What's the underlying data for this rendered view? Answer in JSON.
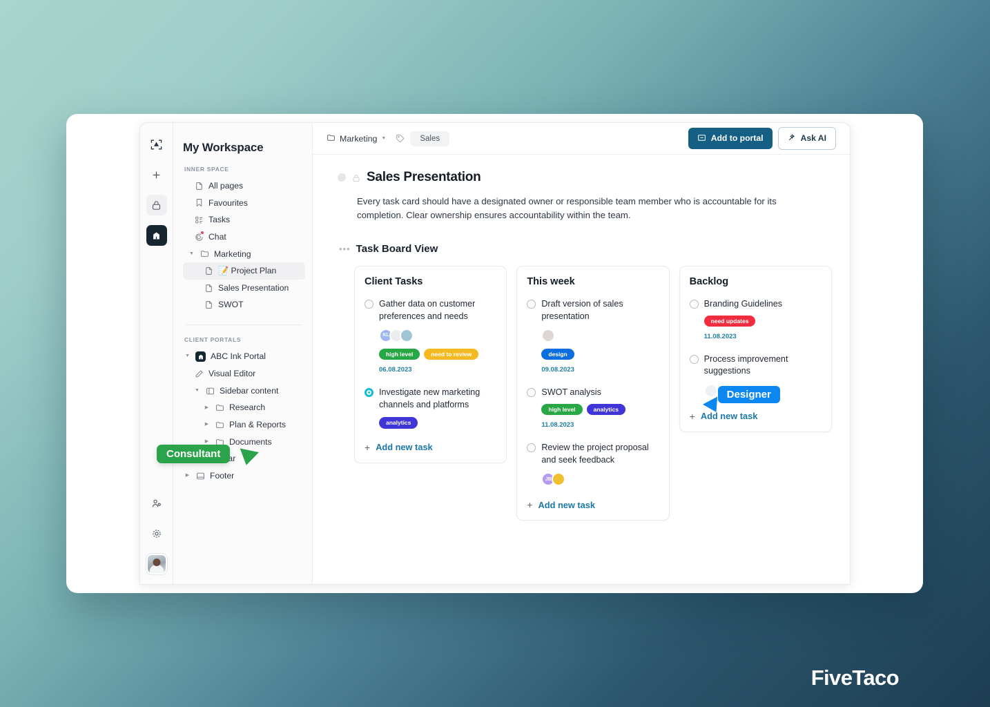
{
  "brand": {
    "watermark": "FiveTaco"
  },
  "colors": {
    "primary_button": "#165f84",
    "accent_link": "#1b78a8",
    "cursor_consultant": "#2aa34a",
    "cursor_designer": "#0d87f0",
    "tag_high_level": "#28a745",
    "tag_need_to_review": "#f5b922",
    "tag_analytics": "#4035d6",
    "tag_design": "#0d6ee0",
    "tag_need_updates": "#f12d3f",
    "bg_top_left": "#a7d6cd",
    "bg_bottom_right": "#1e3d52"
  },
  "rail": {
    "items": [
      {
        "name": "logo-icon",
        "glyph": "logo"
      },
      {
        "name": "add-icon",
        "glyph": "+"
      },
      {
        "name": "lock-icon",
        "glyph": "lock"
      },
      {
        "name": "portal-icon",
        "glyph": "portal"
      }
    ],
    "bottom_items": [
      {
        "name": "members-icon",
        "glyph": "members"
      },
      {
        "name": "settings-icon",
        "glyph": "gear"
      },
      {
        "name": "user-avatar",
        "glyph": "avatar"
      }
    ]
  },
  "sidebar": {
    "workspace_title": "My Workspace",
    "section_inner": "INNER SPACE",
    "section_portals": "CLIENT PORTALS",
    "inner_items": [
      {
        "label": "All pages",
        "icon": "page-icon",
        "indent": 1,
        "caret": false,
        "active": false
      },
      {
        "label": "Favourites",
        "icon": "bookmark-icon",
        "indent": 1,
        "caret": false,
        "active": false
      },
      {
        "label": "Tasks",
        "icon": "tasks-icon",
        "indent": 1,
        "caret": false,
        "active": false
      },
      {
        "label": "Chat",
        "icon": "chat-icon",
        "indent": 1,
        "caret": false,
        "active": false,
        "badge": true
      },
      {
        "label": "Marketing",
        "icon": "folder-icon",
        "indent": 1,
        "caret": true,
        "expanded": true,
        "active": false
      },
      {
        "label": "📝 Project Plan",
        "icon": "page-icon",
        "indent": 2,
        "caret": false,
        "active": true
      },
      {
        "label": "Sales Presentation",
        "icon": "page-icon",
        "indent": 2,
        "caret": false,
        "active": false
      },
      {
        "label": "SWOT",
        "icon": "page-icon",
        "indent": 2,
        "caret": false,
        "active": false
      }
    ],
    "portal_items": [
      {
        "label": "ABC Ink Portal",
        "icon": "portal-mark-icon",
        "indent": 0,
        "caret": true,
        "expanded": true
      },
      {
        "label": "Visual Editor",
        "icon": "pencil-icon",
        "indent": 1,
        "caret": false
      },
      {
        "label": "Sidebar content",
        "icon": "sidebar-panel-icon",
        "indent": 1,
        "caret": true,
        "expanded": true
      },
      {
        "label": "Research",
        "icon": "folder-icon",
        "indent": 2,
        "caret": true
      },
      {
        "label": "Plan & Reports",
        "icon": "folder-icon",
        "indent": 2,
        "caret": true
      },
      {
        "label": "Documents",
        "icon": "folder-icon",
        "indent": 2,
        "caret": true
      },
      {
        "label": "Topbar",
        "icon": "topbar-icon",
        "indent": 0,
        "caret": true
      },
      {
        "label": "Footer",
        "icon": "footer-icon",
        "indent": 0,
        "caret": true
      }
    ],
    "cursor_label": "Consultant"
  },
  "topbar": {
    "breadcrumb_folder": "Marketing",
    "tag_chip": "Sales",
    "add_to_portal_label": "Add to portal",
    "ask_ai_label": "Ask AI"
  },
  "document": {
    "title": "Sales Presentation",
    "paragraph": "Every task card should have a designated owner or responsible team member who is accountable for its completion. Clear ownership ensures accountability within the team.",
    "section_heading": "Task Board View"
  },
  "board": {
    "add_task_label": "Add new task",
    "columns": [
      {
        "title": "Client Tasks",
        "tasks": [
          {
            "text": "Gather data on customer preferences and needs",
            "checked": false,
            "avatars": [
              {
                "type": "initials",
                "text": "KL",
                "color": "#9fb6f0"
              },
              {
                "type": "photo",
                "skin": "#e0b89a",
                "hair": "#3b2b24",
                "shirt": "#e9edf0"
              },
              {
                "type": "photo",
                "skin": "#dba97f",
                "hair": "#4a3226",
                "shirt": "#9fc4d6"
              }
            ],
            "tags": [
              {
                "label": "high level",
                "color": "#28a745"
              },
              {
                "label": "need to review",
                "color": "#f5b922"
              }
            ],
            "date": "06.08.2023"
          },
          {
            "text": "Investigate new marketing channels and platforms",
            "checked": true,
            "avatars": [],
            "tags": [
              {
                "label": "analytics",
                "color": "#4035d6"
              }
            ],
            "date": ""
          }
        ]
      },
      {
        "title": "This week",
        "tasks": [
          {
            "text": "Draft version of sales presentation",
            "checked": false,
            "avatars": [
              {
                "type": "photo",
                "skin": "#e8bb9c",
                "hair": "#8a5a3b",
                "shirt": "#ded6d2"
              }
            ],
            "tags": [
              {
                "label": "design",
                "color": "#0d6ee0"
              }
            ],
            "date": "09.08.2023"
          },
          {
            "text": "SWOT analysis",
            "checked": false,
            "avatars": [],
            "tags": [
              {
                "label": "high level",
                "color": "#28a745"
              },
              {
                "label": "analytics",
                "color": "#4035d6"
              }
            ],
            "date": "11.08.2023"
          },
          {
            "text": "Review the project proposal and seek feedback",
            "checked": false,
            "avatars": [
              {
                "type": "initials",
                "text": "JB",
                "color": "#b69cf0"
              },
              {
                "type": "photo",
                "skin": "#e8bb9c",
                "hair": "#2e2118",
                "shirt": "#f0c030"
              }
            ],
            "tags": [],
            "date": ""
          }
        ]
      },
      {
        "title": "Backlog",
        "tasks": [
          {
            "text": "Branding Guidelines",
            "checked": false,
            "avatars": [],
            "tags": [
              {
                "label": "need updates",
                "color": "#f12d3f"
              }
            ],
            "date": "11.08.2023"
          },
          {
            "text": "Process improvement suggestions",
            "checked": false,
            "avatars": [
              {
                "type": "photo",
                "skin": "#e4b895",
                "hair": "#2b2119",
                "shirt": "#eef1f3"
              }
            ],
            "tags": [],
            "date": ""
          }
        ]
      }
    ],
    "cursor_label": "Designer"
  }
}
